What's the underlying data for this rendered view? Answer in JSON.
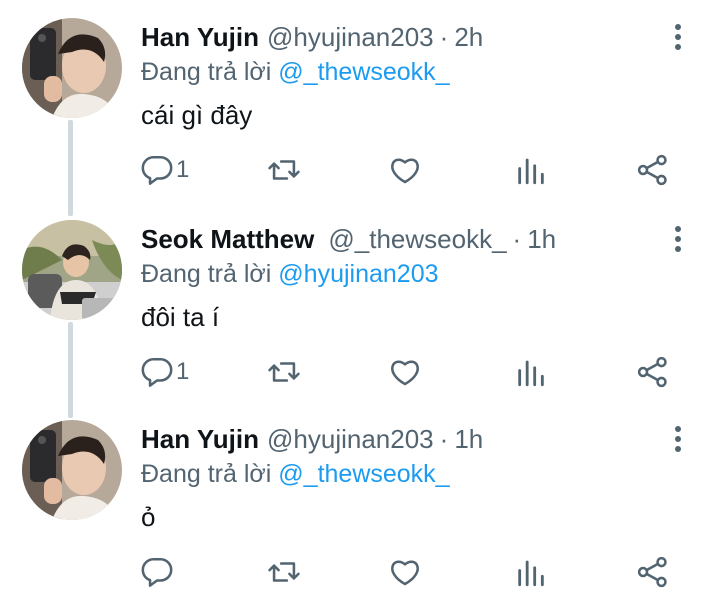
{
  "colors": {
    "accent": "#1d9bf0",
    "secondary_text": "#536471",
    "thread_line": "#cfd9de"
  },
  "tweets": [
    {
      "name": "Han Yujin",
      "handle": "@hyujinan203",
      "separator": "·",
      "time": "2h",
      "reply_prefix": "Đang trả lời ",
      "reply_to": "@_thewseokk_",
      "text": "cái gì đây",
      "reply_count": "1",
      "avatar": "han-yujin-selfie"
    },
    {
      "name": "Seok Matthew",
      "handle": "@_thewseokk_",
      "separator": "·",
      "time": "1h",
      "reply_prefix": "Đang trả lời ",
      "reply_to": "@hyujinan203",
      "text": "đôi ta í",
      "reply_count": "1",
      "avatar": "seok-matthew-photo"
    },
    {
      "name": "Han Yujin",
      "handle": "@hyujinan203",
      "separator": "·",
      "time": "1h",
      "reply_prefix": "Đang trả lời ",
      "reply_to": "@_thewseokk_",
      "text": "ỏ",
      "reply_count": "",
      "avatar": "han-yujin-selfie"
    }
  ],
  "icons": [
    "reply-icon",
    "retweet-icon",
    "like-icon",
    "analytics-icon",
    "share-icon",
    "more-options-icon"
  ]
}
